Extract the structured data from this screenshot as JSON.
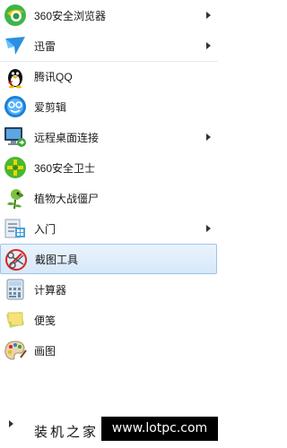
{
  "menu": {
    "items": [
      {
        "label": "360安全浏览器",
        "icon": "360-browser-icon",
        "has_submenu": true
      },
      {
        "label": "迅雷",
        "icon": "xunlei-icon",
        "has_submenu": true
      },
      {
        "label": "腾讯QQ",
        "icon": "qq-penguin-icon",
        "has_submenu": false
      },
      {
        "label": "爱剪辑",
        "icon": "aijianji-icon",
        "has_submenu": false
      },
      {
        "label": "远程桌面连接",
        "icon": "remote-desktop-icon",
        "has_submenu": true
      },
      {
        "label": "360安全卫士",
        "icon": "360-safe-icon",
        "has_submenu": false
      },
      {
        "label": "植物大战僵尸",
        "icon": "plants-vs-zombies-icon",
        "has_submenu": false
      },
      {
        "label": "入门",
        "icon": "getting-started-icon",
        "has_submenu": true
      },
      {
        "label": "截图工具",
        "icon": "snipping-tool-icon",
        "has_submenu": false,
        "selected": true
      },
      {
        "label": "计算器",
        "icon": "calculator-icon",
        "has_submenu": false
      },
      {
        "label": "便笺",
        "icon": "sticky-notes-icon",
        "has_submenu": false
      },
      {
        "label": "画图",
        "icon": "paint-icon",
        "has_submenu": false
      }
    ]
  },
  "footer": {
    "watermark_text": "装机之家",
    "watermark_url": "www.lotpc.com"
  },
  "colors": {
    "selected_bg": "#d6e8fa",
    "selected_border": "#9fc3e8"
  }
}
